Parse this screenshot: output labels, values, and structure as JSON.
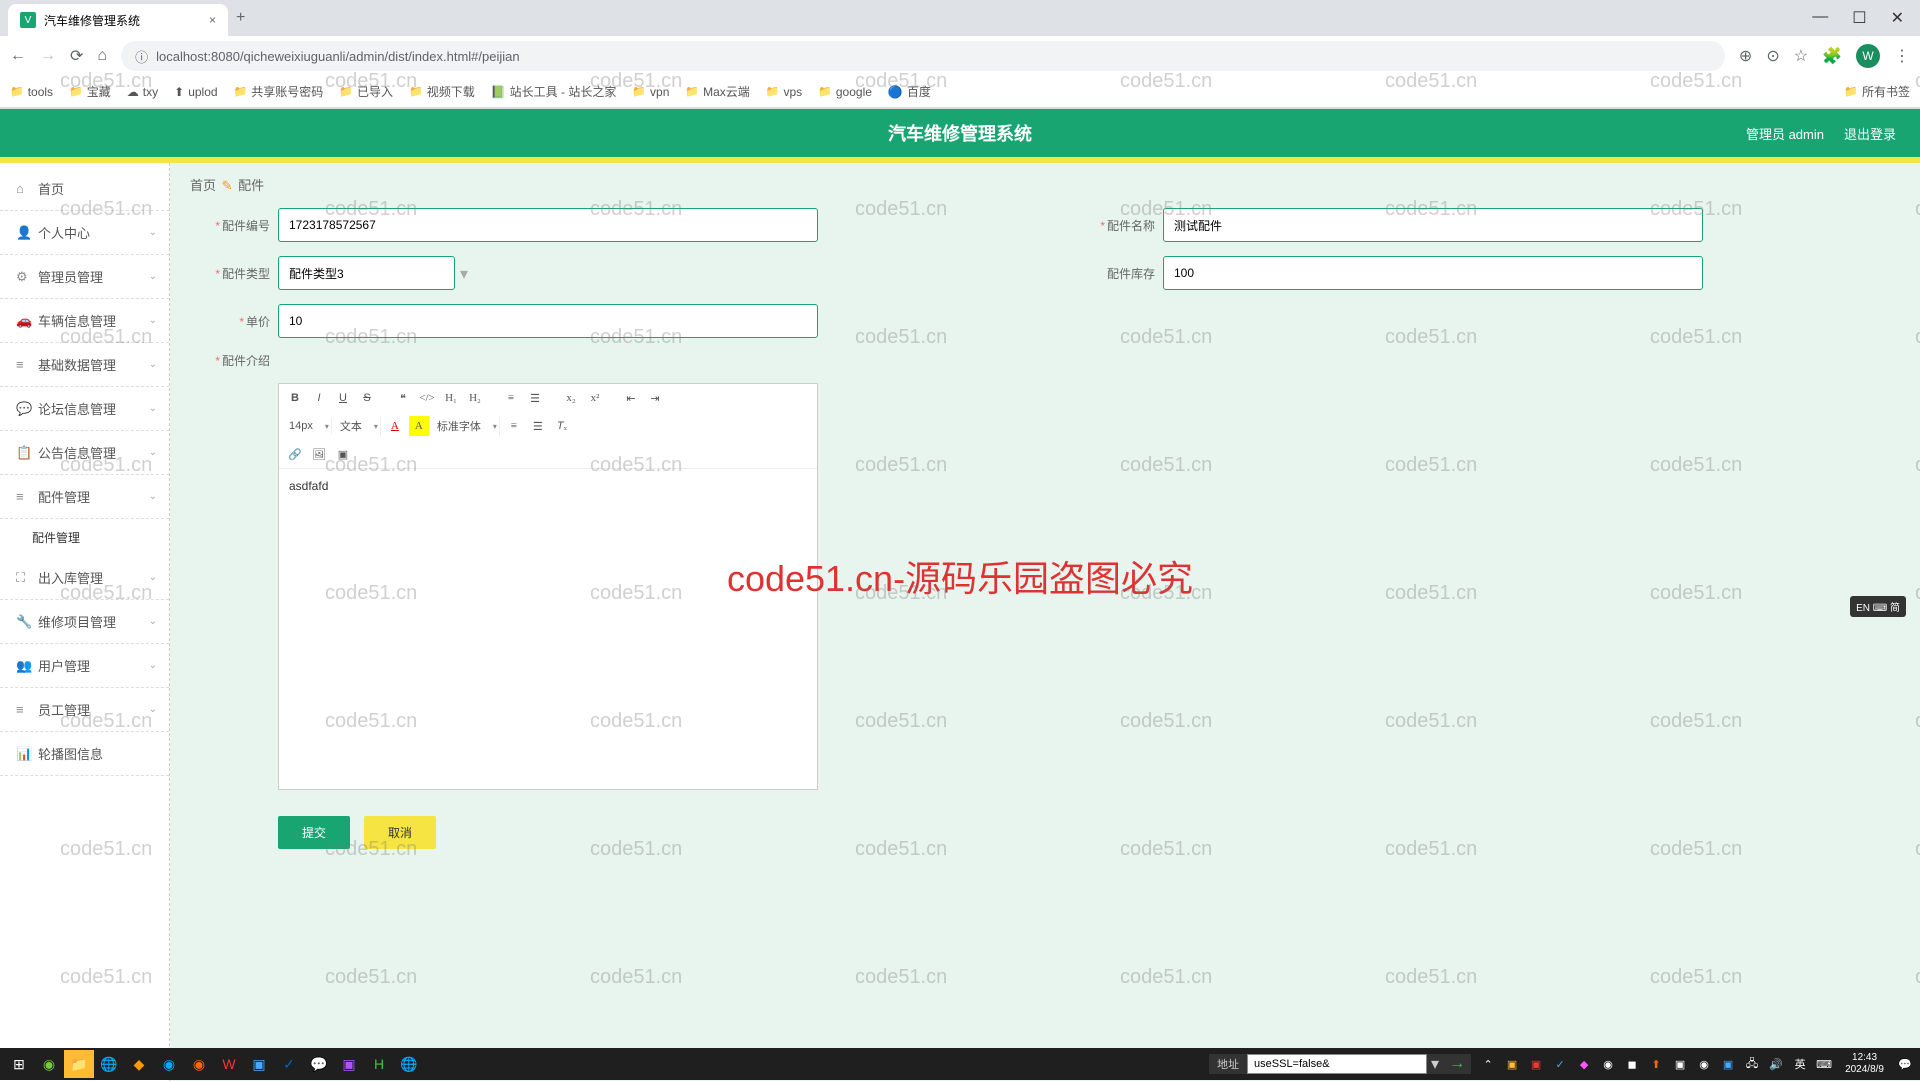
{
  "browser": {
    "tab_title": "汽车维修管理系统",
    "url_host": "localhost:8080",
    "url_path": "/qicheweixiuguanli/admin/dist/index.html#/peijian",
    "avatar_letter": "W",
    "bookmarks": [
      "tools",
      "宝藏",
      "txy",
      "uplod",
      "共享账号密码",
      "已导入",
      "视频下载",
      "站长工具 - 站长之家",
      "vpn",
      "Max云端",
      "vps",
      "google",
      "百度"
    ],
    "bookmarks_right": "所有书签"
  },
  "app": {
    "title": "汽车维修管理系统",
    "admin_label": "管理员 admin",
    "logout": "退出登录"
  },
  "sidebar": {
    "items": [
      {
        "icon": "⌂",
        "label": "首页",
        "arrow": false
      },
      {
        "icon": "👤",
        "label": "个人中心",
        "arrow": true
      },
      {
        "icon": "⚙",
        "label": "管理员管理",
        "arrow": true
      },
      {
        "icon": "🚗",
        "label": "车辆信息管理",
        "arrow": true
      },
      {
        "icon": "≡",
        "label": "基础数据管理",
        "arrow": true
      },
      {
        "icon": "💬",
        "label": "论坛信息管理",
        "arrow": true
      },
      {
        "icon": "📋",
        "label": "公告信息管理",
        "arrow": true
      },
      {
        "icon": "≡",
        "label": "配件管理",
        "arrow": true
      },
      {
        "icon": "⛶",
        "label": "出入库管理",
        "arrow": true
      },
      {
        "icon": "🔧",
        "label": "维修项目管理",
        "arrow": true
      },
      {
        "icon": "👥",
        "label": "用户管理",
        "arrow": true
      },
      {
        "icon": "≡",
        "label": "员工管理",
        "arrow": true
      },
      {
        "icon": "📊",
        "label": "轮播图信息",
        "arrow": false
      }
    ],
    "sub_label": "配件管理"
  },
  "breadcrumb": {
    "home": "首页",
    "current": "配件"
  },
  "form": {
    "code_label": "配件编号",
    "code_value": "1723178572567",
    "name_label": "配件名称",
    "name_value": "测试配件",
    "type_label": "配件类型",
    "type_value": "配件类型3",
    "stock_label": "配件库存",
    "stock_value": "100",
    "price_label": "单价",
    "price_value": "10",
    "desc_label": "配件介绍",
    "editor_font_size": "14px",
    "editor_text_style": "文本",
    "editor_font_family": "标准字体",
    "editor_content": "asdfafd",
    "submit": "提交",
    "cancel": "取消"
  },
  "watermark": {
    "text": "code51.cn",
    "big": "code51.cn-源码乐园盗图必究"
  },
  "ime": "EN ⌨ 简",
  "taskbar": {
    "addr_label": "地址",
    "addr_value": "useSSL=false&",
    "time": "12:43",
    "date": "2024/8/9",
    "lang": "英"
  }
}
